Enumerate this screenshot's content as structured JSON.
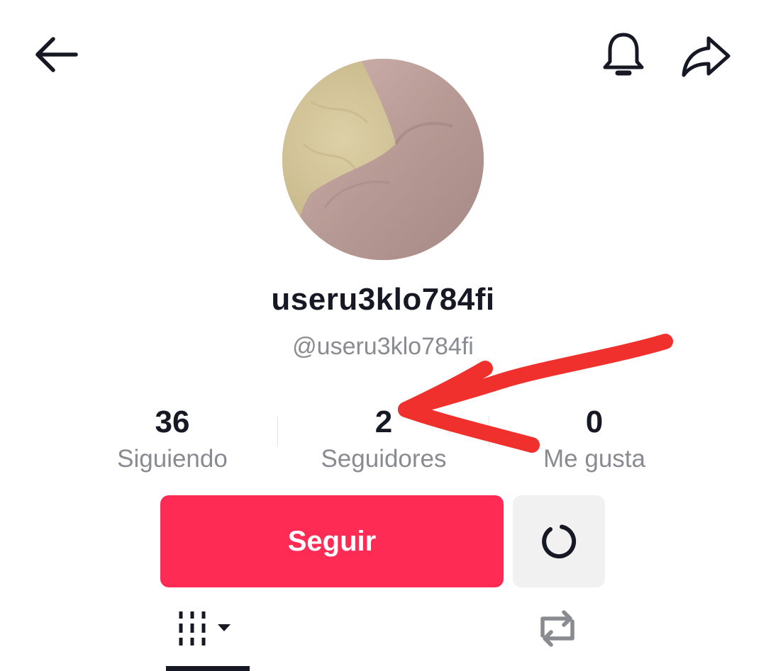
{
  "header": {
    "back_icon": "arrow-left-icon",
    "bell_icon": "bell-icon",
    "share_icon": "share-arrow-icon"
  },
  "profile": {
    "display_name": "useru3klo784fi",
    "handle": "@useru3klo784fi"
  },
  "stats": [
    {
      "value": "36",
      "label": "Siguiendo"
    },
    {
      "value": "2",
      "label": "Seguidores"
    },
    {
      "value": "0",
      "label": "Me gusta"
    }
  ],
  "actions": {
    "follow_label": "Seguir",
    "suggest_icon": "refresh-circle-icon"
  },
  "tabs": [
    {
      "icon": "grid-dropdown-icon",
      "selected": true
    },
    {
      "icon": "repost-icon",
      "selected": false
    }
  ],
  "colors": {
    "accent": "#fe2c55",
    "annotation": "#f0302c",
    "secondary_text": "#8a8b91"
  }
}
